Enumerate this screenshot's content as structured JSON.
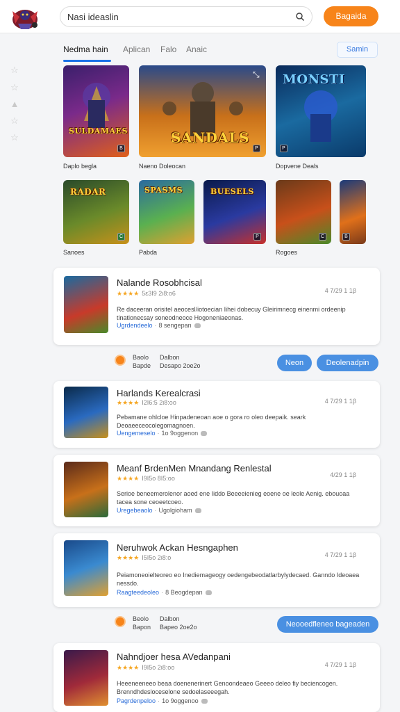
{
  "header": {
    "search_value": "Nasi ideaslin",
    "primary_button": "Bagaida"
  },
  "tabs": {
    "items": [
      "Nedma hain",
      "Aplican",
      "Falo",
      "Anaic"
    ],
    "side_button": "Samin"
  },
  "featured": {
    "row1": [
      {
        "label": "Daplo begla",
        "art_title": "SULDAMAES",
        "badge": "B"
      },
      {
        "label": "Naeno Doleocan",
        "art_title": "SANDALS",
        "badge": "P"
      },
      {
        "label": "Dopvene Deals",
        "art_title": "MONSTI",
        "badge": "P"
      }
    ],
    "row2": [
      {
        "label": "Sanoes",
        "art_title": "RADAR",
        "badge": "C"
      },
      {
        "label": "Pabda",
        "art_title": "SPASMS",
        "badge": ""
      },
      {
        "label": "",
        "art_title": "BUESELS",
        "badge": "P"
      },
      {
        "label": "Rogoes",
        "art_title": "",
        "badge": "C"
      },
      {
        "label": "",
        "art_title": "",
        "badge": "B"
      }
    ]
  },
  "cards": [
    {
      "title": "Nalande Rosobhcisal",
      "stars": "★★★★",
      "rating_meta": "5ε3Ι9 2ι8:ο6",
      "meta": "4 7/29 1 1β",
      "desc": "Re daceeran orisitel aeocesl/iotoecian Iihei dobecuy Gleirimnecg einenmi ordeenip tinationecsay soneodneoce Hogoneniaeonas.",
      "link": "Ugrdendeelo",
      "count": "8 sengepan"
    },
    {
      "title": "Harlands Kerealcrasi",
      "stars": "★★★★",
      "rating_meta": "Ι2Ι6:5 2ι8:οο",
      "meta": "4 7/29 1 1β",
      "desc": "Pebamane ohlcloe Hinpadeneoan aoe o gora ro oleo deepaik. seark Deoaeeceocolegomagnoen.",
      "link": "Uengemeselo",
      "count": "1ο 9oggenon"
    },
    {
      "title": "Meanf BrdenMen Mnandang Renlestal",
      "stars": "★★★★",
      "rating_meta": "Ι9Ι5ο 8Ι5:οο",
      "meta": "4/29 1 1β",
      "desc": "Serioe beneemerolenor aoed ene Iiddo Beeeeienieg eoene oe leole Aenig. ebouoaa tacea sone ceoeetcoeo.",
      "link": "Uregebeaolo",
      "count": "Ugolgioham"
    },
    {
      "title": "Neruhwok Ackan Hesngaphen",
      "stars": "★★★★",
      "rating_meta": "Ι5Ι5ο 2ι8:ο",
      "meta": "4 7/29 1 1β",
      "desc": "Peiamoneoielteoreo eo Inediemageogy oedengebeodatlarbylydecaed. Ganndo Ideoaea nessdo.",
      "link": "Raagteedeoleo",
      "count": "8 Beogdepan"
    },
    {
      "title": "Nahndjoer hesa AVedanpani",
      "stars": "★★★★",
      "rating_meta": "Ι9Ι5ο 2ι8:οο",
      "meta": "4 7/29 1 1β",
      "desc": "Heeeneeneeo beaa doenenerinert Genoondeaeo Geeeo deleo fiy beciencogen. Brenndhdesloceselone sedoelaseeegah.",
      "link": "Pagrdenpeloo",
      "count": "1ο 9oggenoo"
    }
  ],
  "action_row_1": {
    "a1": "Baolo",
    "a2": "Bapde",
    "b1": "Dalbon",
    "b2": "Desapo 2oe2o",
    "btn1": "Neon",
    "btn2": "Deolenadpin"
  },
  "action_row_2": {
    "a1": "Beolo",
    "a2": "Bapon",
    "b1": "Dalbon",
    "b2": "Bapeo 2oe2o",
    "btn": "Neooedfleneo bageaden"
  },
  "colors": {
    "accent": "#f7841a",
    "link": "#2a6cd8",
    "button": "#4a90e2",
    "tab_underline": "#1a73e8"
  }
}
